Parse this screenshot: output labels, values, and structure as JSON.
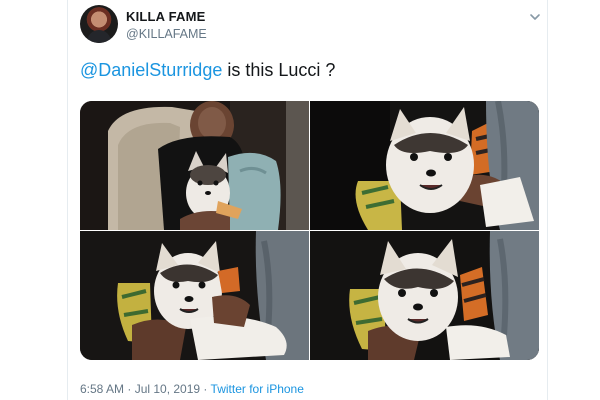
{
  "tweet": {
    "display_name": "KILLA FAME",
    "handle": "@KILLAFAME",
    "mention": "@DanielSturridge",
    "body_text": " is this Lucci ?",
    "timestamp": "6:58 AM · Jul 10, 2019",
    "separator": " · ",
    "source": "Twitter for iPhone"
  },
  "icons": {
    "menu": "chevron-down-icon",
    "avatar": "avatar"
  },
  "colors": {
    "link": "#1b95e0",
    "text": "#14171a",
    "muted": "#657786"
  }
}
